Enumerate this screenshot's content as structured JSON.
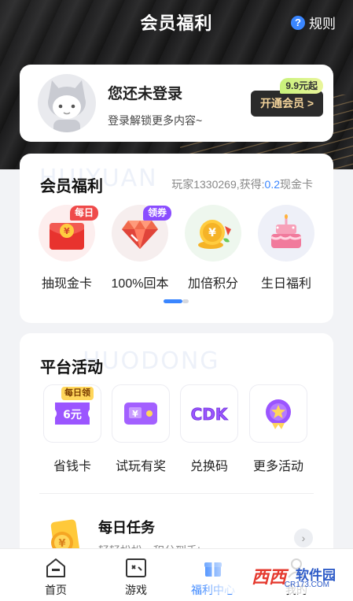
{
  "header": {
    "title": "会员福利",
    "rules_label": "规则",
    "rules_icon": "question-icon"
  },
  "login_card": {
    "title": "您还未登录",
    "subtitle": "登录解锁更多内容~",
    "vip_button": "开通会员 >",
    "vip_price_tag": "9.9元起"
  },
  "benefits": {
    "title": "会员福利",
    "watermark": "HUIYUAN",
    "stat_prefix": "玩家1330269,获得:",
    "stat_value": "0.2",
    "stat_suffix": "现金卡",
    "items": [
      {
        "label": "抽现金卡",
        "badge": "每日",
        "icon": "red-envelope-icon"
      },
      {
        "label": "100%回本",
        "badge": "领券",
        "icon": "diamond-icon"
      },
      {
        "label": "加倍积分",
        "badge": "",
        "icon": "gold-coin-icon"
      },
      {
        "label": "生日福利",
        "badge": "",
        "icon": "birthday-cake-icon"
      }
    ],
    "page_indicator": {
      "current": 1,
      "total": 2
    }
  },
  "platform": {
    "title": "平台活动",
    "watermark": "HUODONG",
    "items": [
      {
        "label": "省钱卡",
        "badge": "每日领",
        "card_text": "6元",
        "icon": "ticket-icon"
      },
      {
        "label": "试玩有奖",
        "badge": "",
        "icon": "game-card-icon"
      },
      {
        "label": "兑换码",
        "badge": "",
        "card_text": "CDK",
        "icon": "cdk-icon"
      },
      {
        "label": "更多活动",
        "badge": "",
        "icon": "star-medal-icon"
      }
    ],
    "task": {
      "title": "每日任务",
      "subtitle": "轻轻松松，积分到手!",
      "icon": "task-coin-icon"
    }
  },
  "tabbar": {
    "tabs": [
      {
        "label": "首页",
        "icon": "home-icon",
        "active": false
      },
      {
        "label": "游戏",
        "icon": "game-icon",
        "active": false
      },
      {
        "label": "福利中心",
        "icon": "gift-icon",
        "active": true
      },
      {
        "label": "我的",
        "icon": "user-icon",
        "active": false
      }
    ]
  },
  "watermark_corner": {
    "brand": "西西",
    "name": "软件园",
    "domain": "CR173.COM"
  },
  "colors": {
    "accent": "#3a86ff",
    "gold_text": "#f3d39a",
    "vip_button_bg": "#2b2b2b",
    "badge_red": "#ef4a4a",
    "badge_purple": "#8a4dff"
  }
}
